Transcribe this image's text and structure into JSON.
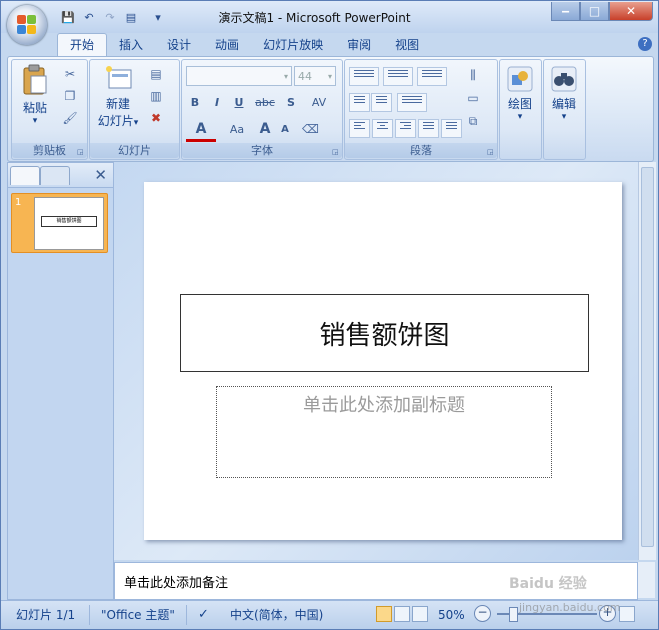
{
  "window": {
    "title": "演示文稿1 - Microsoft PowerPoint",
    "minimize": "‒",
    "maximize": "□",
    "close": "✕"
  },
  "quick_access": {
    "save": "💾",
    "undo": "↶",
    "redo": "↷",
    "print": "▤",
    "customize": "▾"
  },
  "tabs": [
    "开始",
    "插入",
    "设计",
    "动画",
    "幻灯片放映",
    "审阅",
    "视图"
  ],
  "help": "?",
  "ribbon": {
    "clipboard": {
      "label": "剪贴板",
      "paste": "粘贴",
      "paste_arrow": "▾"
    },
    "slides": {
      "label": "幻灯片",
      "new_slide_line1": "新建",
      "new_slide_line2": "幻灯片",
      "arrow": "▾"
    },
    "font": {
      "label": "字体",
      "font_name": "",
      "font_size": "44",
      "bold": "B",
      "italic": "I",
      "underline": "U",
      "strike": "abc",
      "shadow": "S",
      "spacing": "AV",
      "font_color": "A",
      "case": "Aa",
      "grow": "A",
      "shrink": "A"
    },
    "paragraph": {
      "label": "段落"
    },
    "drawing": {
      "label": "绘图",
      "arrow": "▾"
    },
    "editing": {
      "label": "编辑",
      "arrow": "▾"
    }
  },
  "left_pane": {
    "close": "✕",
    "thumb_number": "1",
    "thumb_title": "销售额饼图"
  },
  "slide": {
    "title": "销售额饼图",
    "subtitle_placeholder": "单击此处添加副标题"
  },
  "notes": {
    "placeholder": "单击此处添加备注"
  },
  "statusbar": {
    "slide_count": "幻灯片 1/1",
    "theme": "\"Office 主题\"",
    "language": "中文(简体，中国)",
    "zoom": "50%",
    "zoom_minus": "−",
    "zoom_plus": "+"
  },
  "watermark": {
    "text": "Baidu 经验",
    "url": "jingyan.baidu.com"
  },
  "colors": {
    "accent": "#15428b",
    "ribbon_bg": "#dbe7f6",
    "selected_thumb": "#f7b552"
  }
}
